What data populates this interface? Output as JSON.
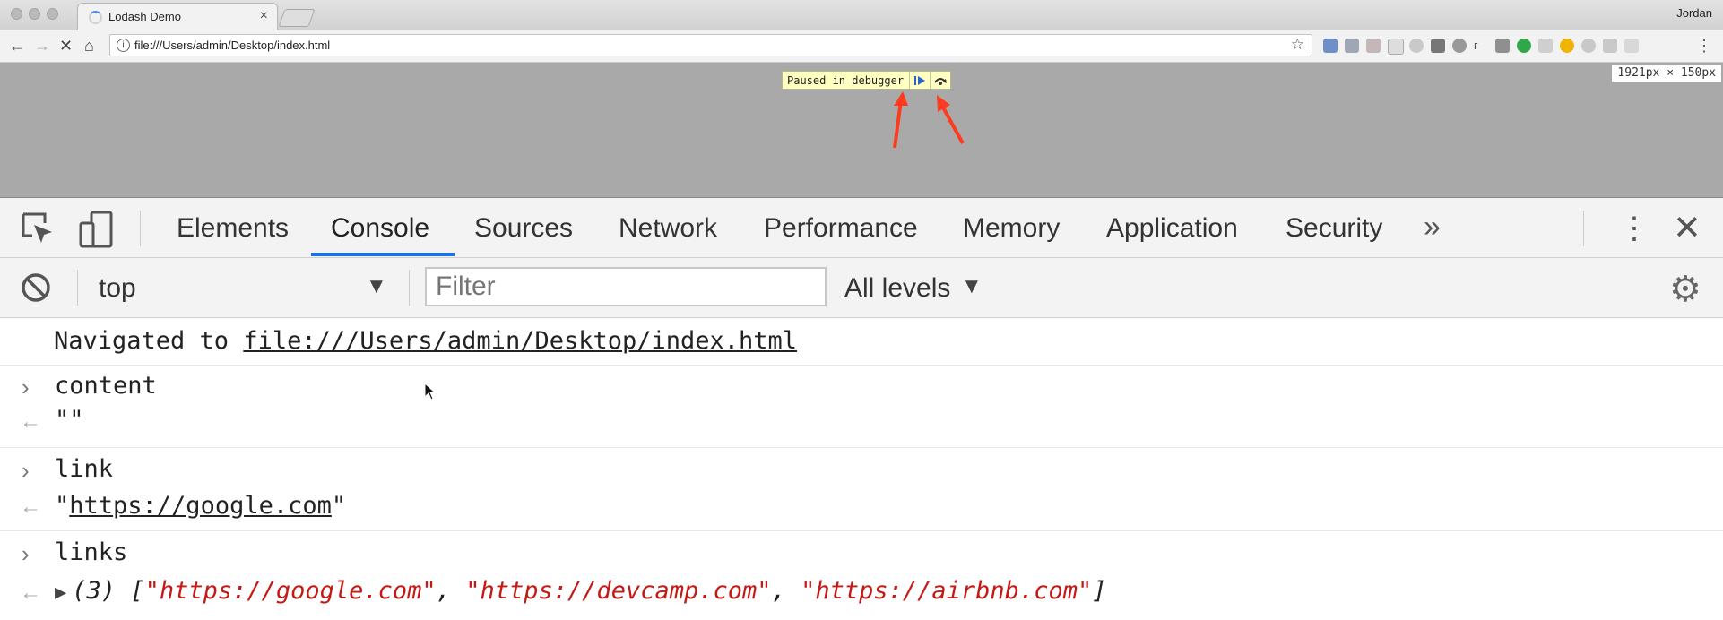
{
  "browser": {
    "tab_title": "Lodash Demo",
    "tab_close": "×",
    "user": "Jordan",
    "url": "file:///Users/admin/Desktop/index.html"
  },
  "page": {
    "paused_text": "Paused in debugger",
    "dimensions": "1921px × 150px"
  },
  "devtools": {
    "tabs": [
      "Elements",
      "Console",
      "Sources",
      "Network",
      "Performance",
      "Memory",
      "Application",
      "Security"
    ],
    "active_tab": "Console",
    "context": "top",
    "filter_placeholder": "Filter",
    "levels": "All levels"
  },
  "console": {
    "navigated_prefix": "Navigated to",
    "navigated_url": "file:///Users/admin/Desktop/index.html",
    "entries": [
      {
        "input": "content",
        "output": "\"\""
      },
      {
        "input": "link",
        "output_quote_open": "\"",
        "output_link": "https://google.com",
        "output_quote_close": "\""
      },
      {
        "input": "links",
        "output_count": "(3)",
        "output_open": "[",
        "items": [
          "\"https://google.com\"",
          "\"https://devcamp.com\"",
          "\"https://airbnb.com\""
        ],
        "sep": ",",
        "output_close": "]"
      }
    ]
  },
  "colors": {
    "accent": "#1a73e8",
    "string": "#c41a16",
    "paused_bg": "#ffffc2",
    "red_arrow": "#ff3b1f"
  }
}
